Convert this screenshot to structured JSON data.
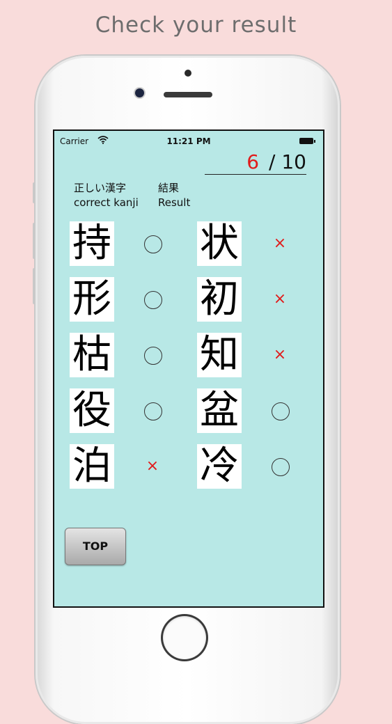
{
  "headline": "Check your result",
  "status_bar": {
    "carrier": "Carrier",
    "time": "11:21 PM"
  },
  "score": {
    "correct": "6",
    "total": "/ 10"
  },
  "headers": {
    "kanji_jp": "正しい漢字",
    "kanji_en": "correct kanji",
    "result_jp": "結果",
    "result_en": "Result"
  },
  "results": [
    {
      "kanji": "持",
      "mark": "○"
    },
    {
      "kanji": "形",
      "mark": "○"
    },
    {
      "kanji": "枯",
      "mark": "○"
    },
    {
      "kanji": "役",
      "mark": "○"
    },
    {
      "kanji": "泊",
      "mark": "×"
    },
    {
      "kanji": "状",
      "mark": "×"
    },
    {
      "kanji": "初",
      "mark": "×"
    },
    {
      "kanji": "知",
      "mark": "×"
    },
    {
      "kanji": "盆",
      "mark": "○"
    },
    {
      "kanji": "冷",
      "mark": "○"
    }
  ],
  "top_button": "TOP",
  "colors": {
    "screen_bg": "#b8e8e6",
    "page_bg": "#f9dcdb",
    "wrong_mark": "#e11a1a"
  }
}
